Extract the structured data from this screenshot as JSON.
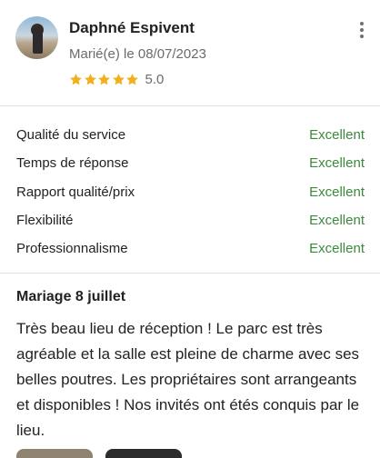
{
  "review": {
    "author_name": "Daphné Espivent",
    "married_date": "Marié(e) le 08/07/2023",
    "rating": 5.0,
    "rating_text": "5.0",
    "stars_filled": 5,
    "title": "Mariage 8 juillet",
    "body": "Très beau lieu de réception ! Le parc est très agréable et la salle est pleine de charme avec ses belles poutres. Les propriétaires sont arrangeants et disponibles ! Nos invités ont étés conquis par le lieu."
  },
  "scores": [
    {
      "label": "Qualité du service",
      "value": "Excellent"
    },
    {
      "label": "Temps de réponse",
      "value": "Excellent"
    },
    {
      "label": "Rapport qualité/prix",
      "value": "Excellent"
    },
    {
      "label": "Flexibilité",
      "value": "Excellent"
    },
    {
      "label": "Professionnalisme",
      "value": "Excellent"
    }
  ],
  "icons": {
    "star": "star-icon",
    "more": "more-options-icon"
  },
  "colors": {
    "star": "#f2b01e",
    "excellent": "#3b8a3b",
    "divider": "#e3e3e3"
  }
}
